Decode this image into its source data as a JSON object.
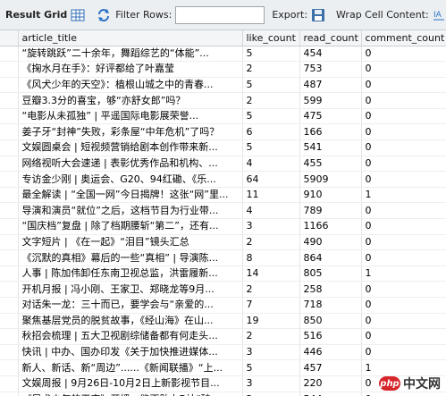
{
  "toolbar": {
    "title": "Result Grid",
    "filter_label": "Filter Rows:",
    "filter_value": "",
    "export_label": "Export:",
    "wrap_label": "Wrap Cell Content:"
  },
  "columns": [
    "article_title",
    "like_count",
    "read_count",
    "comment_count"
  ],
  "rows": [
    [
      "“旋转跳跃”二十余年，舞蹈综艺的“体能”...",
      "5",
      "454",
      "0"
    ],
    [
      "《掬水月在手》：好评都给了叶嘉莹",
      "2",
      "753",
      "0"
    ],
    [
      "《风犬少年的天空》：植根山城之中的青春...",
      "5",
      "487",
      "0"
    ],
    [
      "豆瓣3.3分的喜宝，够“亦舒女郎”吗？",
      "2",
      "599",
      "0"
    ],
    [
      "“电影从未孤独” | 平遥国际电影展荣誉...",
      "5",
      "475",
      "0"
    ],
    [
      "姜子牙“封神”失败，彩条屋“中年危机”了吗？",
      "6",
      "166",
      "0"
    ],
    [
      "文娱圆桌会 | 短视频营销给剧本创作带来新...",
      "5",
      "541",
      "0"
    ],
    [
      "网络视听大会速递 | 表彰优秀作品和机构、...",
      "4",
      "455",
      "0"
    ],
    [
      "专访金少刚 | 奥运会、G20、94红磡、《乐...",
      "64",
      "5909",
      "0"
    ],
    [
      "最全解读 | “全国一网”今日揭牌！这张“网”里...",
      "11",
      "910",
      "1"
    ],
    [
      "导演和演员“就位”之后，这档节目为行业带...",
      "4",
      "789",
      "0"
    ],
    [
      "“国庆档”复盘 | 除了档期腰斩“第二”，还有...",
      "3",
      "1166",
      "0"
    ],
    [
      "文字短片 | 《在一起》“泪目”镜头汇总",
      "2",
      "490",
      "0"
    ],
    [
      "《沉默的真相》幕后的一些“真相” | 导演陈...",
      "8",
      "864",
      "0"
    ],
    [
      "人事 | 陈加伟卸任东南卫视总监，洪雷履新...",
      "14",
      "805",
      "1"
    ],
    [
      "开机月报 | 冯小刚、王家卫、郑晓龙等9月...",
      "2",
      "258",
      "0"
    ],
    [
      "对话朱一龙：三十而已，要学会与“亲爱的...",
      "7",
      "718",
      "0"
    ],
    [
      "聚焦基层党员的脱贫故事，《经山海》在山...",
      "19",
      "850",
      "0"
    ],
    [
      "秋招会梳理 | 五大卫视剧综储备都有何走头...",
      "2",
      "516",
      "0"
    ],
    [
      "快讯 | 中办、国办印发《关于加快推进媒体...",
      "3",
      "446",
      "0"
    ],
    [
      "新人、新话、新“周边”......《新闻联播》“上...",
      "5",
      "457",
      "1"
    ],
    [
      "文娱周报 | 9月26日-10月2日上新影视节目...",
      "3",
      "220",
      "0"
    ],
    [
      "《风犬少年的天空》开播，能否助力B站“破...",
      "2",
      "544",
      "0"
    ]
  ],
  "watermark": {
    "logo_text": "php",
    "text": "中文网"
  },
  "icons": {
    "grid": "grid-icon",
    "refresh": "refresh-icon",
    "export": "floppy-disk-icon",
    "wrap": "wrap-text-icon"
  }
}
